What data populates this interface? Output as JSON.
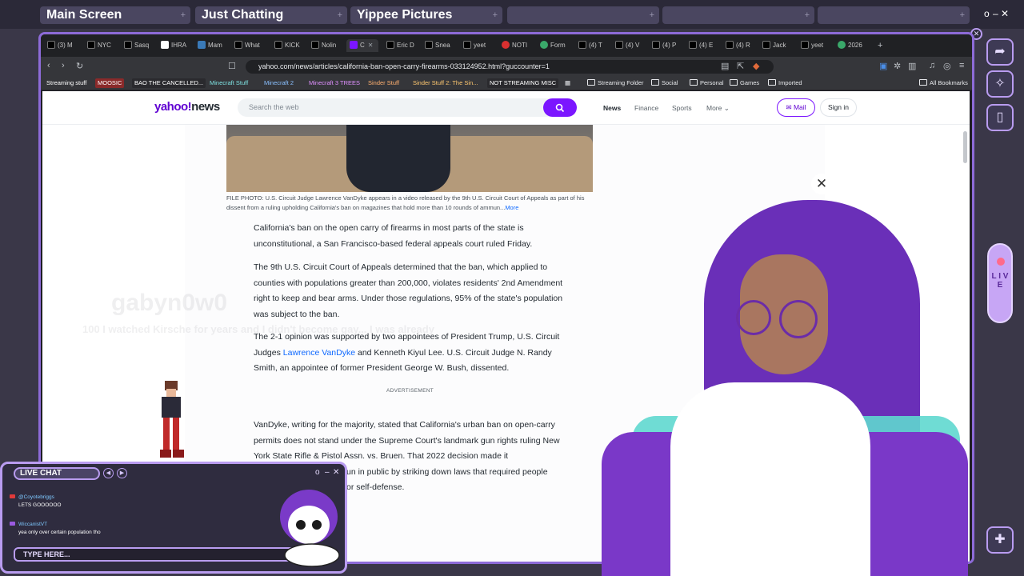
{
  "scenes": {
    "tabs": [
      {
        "label": "Main Screen"
      },
      {
        "label": "Just Chatting"
      },
      {
        "label": "Yippee Pictures"
      },
      {
        "label": ""
      },
      {
        "label": ""
      },
      {
        "label": ""
      }
    ],
    "plus_glyph": "+",
    "window_controls": {
      "min": "o",
      "max": "–",
      "close": "✕"
    }
  },
  "browser": {
    "tabs": [
      "(3) M",
      "NYC",
      "Sasq",
      "IHRA",
      "Mam",
      "What",
      "KICK",
      "Nolin",
      "C",
      "Eric D",
      "Snea",
      "yeet",
      "NOTI",
      "Form",
      "(4) T",
      "(4) V",
      "(4) P",
      "(4) E",
      "(4) R",
      "Jack",
      "yeet",
      "2026"
    ],
    "url": "yahoo.com/news/articles/california-ban-open-carry-firearms-033124952.html?guccounter=1",
    "bookmarks": [
      {
        "label": "Streaming stuff",
        "color": "#4a6fc8"
      },
      {
        "label": "MOOSIC",
        "color": "#c04848"
      },
      {
        "label": "BAO THE CANCELLED...",
        "color": "#444448"
      },
      {
        "label": "Minecraft Stuff",
        "color": "#2e8a8a"
      },
      {
        "label": "Minecraft 2",
        "color": "#3a7ab8"
      },
      {
        "label": "Minecraft 3 TREES",
        "color": "#8e3aa8"
      },
      {
        "label": "Sinder Stuff",
        "color": "#b86a2a"
      },
      {
        "label": "Sinder Stuff 2: The Sin...",
        "color": "#a87a2a"
      },
      {
        "label": "NOT STREAMING MISC",
        "color": "#444448"
      }
    ],
    "bookmark_folders": [
      "Streaming Folder",
      "Social",
      "Personal",
      "Games",
      "Imported"
    ],
    "all_bookmarks": "All Bookmarks"
  },
  "yahoo": {
    "logo_main": "yahoo!",
    "logo_sub": "news",
    "search_placeholder": "Search the web",
    "nav": [
      "News",
      "Finance",
      "Sports",
      "More"
    ],
    "mail": "Mail",
    "sign_in": "Sign in",
    "caption": "FILE PHOTO: U.S. Circuit Judge Lawrence VanDyke appears in a video released by the 9th U.S. Circuit Court of Appeals as part of his dissent from a ruling upholding California's ban on magazines that hold more than 10 rounds of ammun...",
    "caption_more": "More",
    "p1": "California's ban on the open carry of firearms in most parts of the state is unconstitutional, a San Francisco-based federal appeals court ruled Friday.",
    "p2": "The 9th U.S. Circuit Court of Appeals determined that the ban, which applied to counties with populations greater than 200,000, violates residents' 2nd Amendment right to keep and bear arms. Under those regulations, 95% of the state's population was subject to the ban.",
    "p3_a": "The 2-1 opinion was supported by two appointees of President Trump, U.S. Circuit Judges ",
    "p3_link": "Lawrence VanDyke",
    "p3_b": " and Kenneth Kiyul Lee. U.S. Circuit Judge N. Randy Smith, an appointee of former President George W. Bush, dissented.",
    "advertisement": "ADVERTISEMENT",
    "p4": "VanDyke, writing for the majority, stated that California's urban ban on open-carry permits does not stand under the Supreme Court's landmark gun rights ruling New York State Rifle & Pistol Assn. vs. Bruen. That 2022 decision made it",
    "p4_b": "un in public by striking down laws that required people",
    "p4_c": "or self-defense."
  },
  "overlay": {
    "live_letters": "L I V E",
    "ghost_name": "gabyn0w0",
    "ghost_line": "100 I watched Kirsche for years and I didn't become gay... I was already",
    "close_glyph": "✕"
  },
  "chat": {
    "title": "LIVE CHAT",
    "messages": [
      {
        "user": "@Coyotebriggs",
        "text": "LETS GOOOOOO",
        "badge_color": "#e03a3a"
      },
      {
        "user": "WiccanistVT",
        "text": "yea only over certain population tho",
        "badge_color": "#9a5ae0"
      }
    ],
    "input_placeholder": "TYPE HERE...",
    "controls": {
      "min": "o",
      "max": "–",
      "close": "✕"
    }
  },
  "colors": {
    "accent": "#b99cf0",
    "yahoo_purple": "#7b16ff",
    "link": "#0f69ff"
  }
}
